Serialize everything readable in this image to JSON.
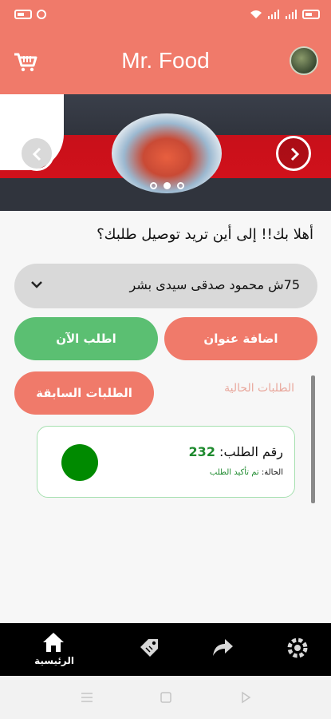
{
  "app": {
    "title": "Mr. Food"
  },
  "icons": {
    "cart": "cart-icon",
    "avatar": "avatar-image",
    "prev": "chevron-left-icon",
    "next": "chevron-right-icon",
    "dropdown": "chevron-down-icon",
    "home": "home-icon",
    "tag": "tag-icon",
    "share": "share-icon",
    "settings": "gear-icon"
  },
  "banner": {
    "slides": 3,
    "active_slide": 2
  },
  "greeting": "أهلا بك!! إلى أين تريد توصيل طلبك؟",
  "address": {
    "selected": "75ش محمود صدقى سيدى بشر"
  },
  "buttons": {
    "add_address": "اضافة عنوان",
    "order_now": "اطلب الآن",
    "previous_orders": "الطلبات السابقة"
  },
  "tabs": {
    "current_orders": "الطلبات الحالية"
  },
  "order": {
    "number_label": "رقم الطلب:",
    "number": "232",
    "status_label": "الحالة:",
    "status": "تم تأكيد الطلب"
  },
  "bottom_nav": {
    "home_label": "الرئيسية"
  },
  "colors": {
    "primary": "#f07a6a",
    "green": "#5bbf72",
    "status_dot": "#008a00",
    "nav_bg": "#000000"
  }
}
